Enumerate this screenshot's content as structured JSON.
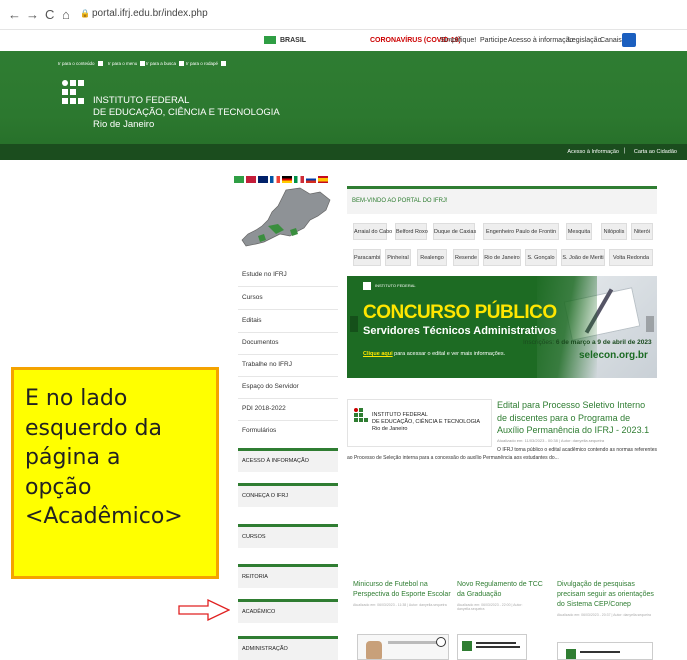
{
  "browser": {
    "url": "portal.ifrj.edu.br/index.php",
    "back_icon": "←",
    "forward_icon": "→",
    "reload_icon": "C",
    "home_icon": "⌂",
    "lock_icon": "🔒"
  },
  "govbar": {
    "brasil": "BRASIL",
    "links": [
      "CORONAVÍRUS (COVID-19)",
      "Simplifique!",
      "Participe",
      "Acesso à informação",
      "Legislação",
      "Canais"
    ]
  },
  "header": {
    "skip_links": [
      "Ir para o conteúdo",
      "Ir para o menu",
      "Ir para a busca",
      "Ir para o rodapé"
    ],
    "title_line1": "INSTITUTO FEDERAL",
    "title_line2": "DE EDUCAÇÃO, CIÊNCIA E TECNOLOGIA",
    "title_line3": "Rio de Janeiro",
    "top_links": [
      "Acesso à Informação",
      "Carta ao Cidadão"
    ]
  },
  "sidebar": {
    "items": [
      "Estude no IFRJ",
      "Cursos",
      "Editais",
      "Documentos",
      "Trabalhe no IFRJ",
      "Espaço do Servidor",
      "PDI 2018-2022",
      "Formulários"
    ],
    "sections": [
      "Acesso à Informação",
      "Conheça o IFRJ",
      "Cursos",
      "Reitoria",
      "Acadêmico",
      "Administração"
    ]
  },
  "main": {
    "welcome": "Bem-vindo ao portal do IFRJ!",
    "campi_row1": [
      "Arraial do Cabo",
      "Belford Roxo",
      "Duque de Caxias",
      "Engenheiro Paulo de Frontin",
      "Mesquita",
      "Nilópolis",
      "Niterói"
    ],
    "campi_row2": [
      "Paracambi",
      "Pinheiral",
      "Realengo",
      "Resende",
      "Rio de Janeiro",
      "S. Gonçalo",
      "S. João de Meriti",
      "Volta Redonda"
    ],
    "banner": {
      "small_logo": "INSTITUTO FEDERAL",
      "title": "CONCURSO PÚBLICO",
      "subtitle": "Servidores Técnicos Administrativos",
      "click_prefix": "Clique aqui",
      "click_rest": " para acessar o edital e ver mais informações.",
      "inscricoes_prefix": "Inscrições: ",
      "inscricoes_date": "6 de março a 9 de abril de 2023",
      "site": "selecon.org.br"
    },
    "news": {
      "logo_line1": "INSTITUTO FEDERAL",
      "logo_line2": "DE EDUCAÇÃO, CIÊNCIA E TECNOLOGIA",
      "logo_line3": "Rio de Janeiro",
      "title": "Edital para Processo Seletivo Interno de discentes para o Programa de Auxílio Permanência do IFRJ - 2023.1",
      "meta": "Atualizado em: 11/03/2023 - 00:38 | Autor: danyella.sequeira",
      "excerpt": "O IFRJ torna público o edital acadêmico contendo as normas referentes ao Processo de Seleção interna para a concessão do auxílio Permanência aos estudantes do..."
    },
    "cards": [
      {
        "title": "Minicurso de Futebol na Perspectiva do Esporte Escolar",
        "meta": "Atualizado em: 06/03/2023 - 11:38 | Autor: danyella.sequeira"
      },
      {
        "title": "Novo Regulamento de TCC da Graduação",
        "meta": "Atualizado em: 06/03/2023 - 22:00 | Autor: danyella.sequeira"
      },
      {
        "title": "Divulgação de pesquisas precisam seguir as orientações do Sistema CEP/Conep",
        "meta": "Atualizado em: 06/03/2023 - 20:37 | Autor: danyella.sequeira"
      }
    ]
  },
  "callout": {
    "text": "E no lado\nesquerdo da\npágina a\nopção\n<Acadêmico>"
  },
  "colors": {
    "ifrj_green": "#2f7d32",
    "dark_green": "#1b4d1e",
    "callout_fill": "#ffff00",
    "callout_border": "#f4a300",
    "arrow": "#e02020"
  }
}
